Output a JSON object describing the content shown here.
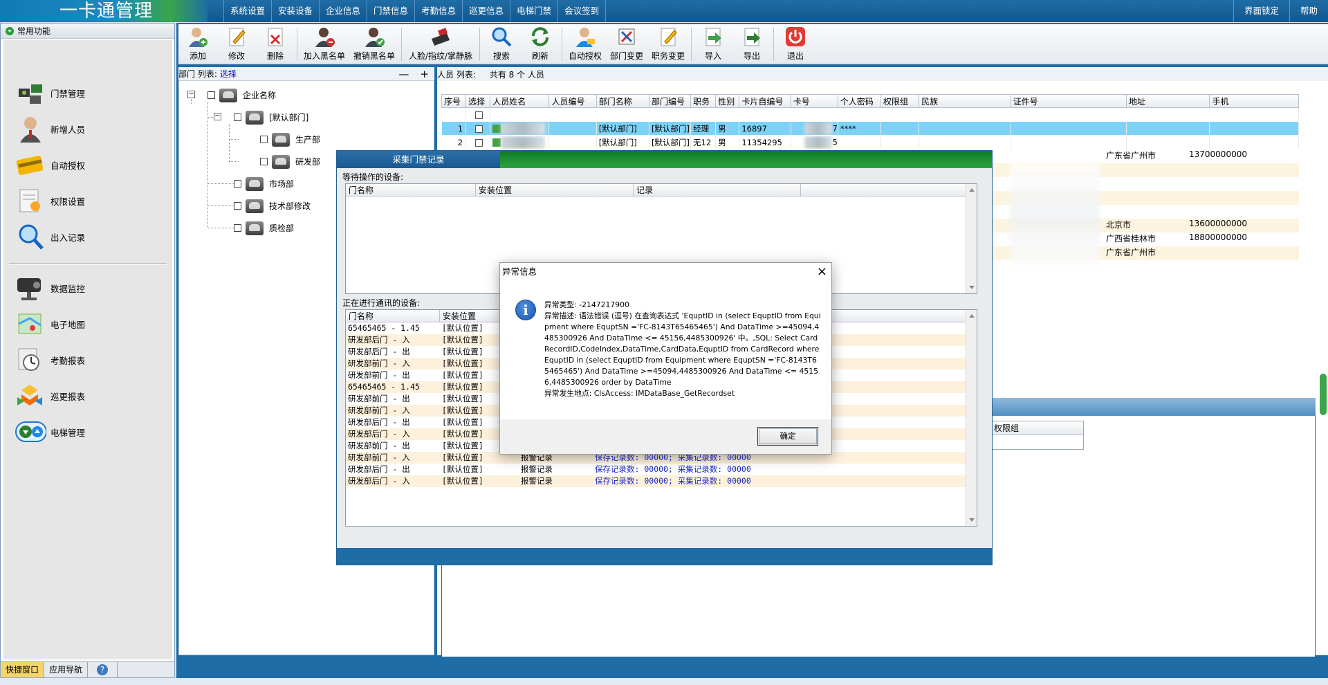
{
  "app": {
    "title": "一卡通管理"
  },
  "menu": [
    "系统设置",
    "安装设备",
    "企业信息",
    "门禁信息",
    "考勤信息",
    "巡更信息",
    "电梯门禁",
    "会议签到"
  ],
  "top_right": [
    "界面锁定",
    "帮助"
  ],
  "sidebar": {
    "header": "常用功能",
    "items": [
      "门禁管理",
      "新增人员",
      "自动授权",
      "权限设置",
      "出入记录",
      "数据监控",
      "电子地图",
      "考勤报表",
      "巡更报表",
      "电梯管理"
    ]
  },
  "bottom_tabs": [
    "快捷窗口",
    "应用导航"
  ],
  "toolbar": [
    "添加",
    "修改",
    "删除",
    "加入黑名单",
    "撤销黑名单",
    "人脸/指纹/掌静脉",
    "搜索",
    "刷新",
    "自动授权",
    "部门变更",
    "职务变更",
    "导入",
    "导出",
    "退出"
  ],
  "dept": {
    "list_label": "部门 列表:",
    "select_label": "选择",
    "minus": "—",
    "plus": "+",
    "nodes": [
      "企业名称",
      "[默认部门]",
      "生产部",
      "研发部",
      "市场部",
      "技术部修改",
      "质检部"
    ]
  },
  "person": {
    "list_label": "人员 列表:",
    "count_label": "共有 8  个 人员",
    "columns": [
      "序号",
      "选择",
      "人员姓名",
      "人员编号",
      "部门名称",
      "部门编号",
      "职务",
      "性别",
      "卡片自编号",
      "卡号",
      "个人密码",
      "权限组",
      "民族",
      "证件号",
      "地址",
      "手机"
    ],
    "rows": [
      {
        "no": "1",
        "dept": "[默认部门]",
        "deptno": "[默认部门]",
        "duty": "经理",
        "sex": "男",
        "cardno": "16897",
        "card_suffix": "7",
        "pwd": "****",
        "addr": "",
        "phone": ""
      },
      {
        "no": "2",
        "dept": "[默认部门]",
        "deptno": "[默认部门]",
        "duty": "无12",
        "sex": "男",
        "cardno": "11354295",
        "card_suffix": "5",
        "pwd": "",
        "addr": "",
        "phone": ""
      }
    ],
    "right_rows": [
      {
        "addr": "广东省广州市",
        "phone": "13700000000"
      },
      {
        "addr": "",
        "phone": ""
      },
      {
        "addr": "",
        "phone": ""
      },
      {
        "addr": "",
        "phone": ""
      },
      {
        "addr": "",
        "phone": ""
      },
      {
        "addr": "北京市",
        "phone": "13600000000"
      },
      {
        "addr": "广西省桂林市",
        "phone": "18800000000"
      },
      {
        "addr": "广东省广州市",
        "phone": ""
      }
    ],
    "lower_header": "权限组"
  },
  "collect": {
    "title": "采集门禁记录",
    "waiting_label": "等待操作的设备:",
    "waiting_cols": [
      "门名称",
      "安装位置",
      "记录"
    ],
    "comm_label": "正在进行通讯的设备:",
    "comm_cols": [
      "门名称",
      "安装位置"
    ],
    "rows": [
      {
        "door": "65465465 - 1.45",
        "loc": "[默认位置]",
        "rec": "",
        "status": ""
      },
      {
        "door": "研发部后门 - 入",
        "loc": "[默认位置]",
        "rec": "",
        "status": ""
      },
      {
        "door": "研发部后门 - 出",
        "loc": "[默认位置]",
        "rec": "",
        "status": ""
      },
      {
        "door": "研发部前门 - 入",
        "loc": "[默认位置]",
        "rec": "",
        "status": ""
      },
      {
        "door": "研发部前门 - 出",
        "loc": "[默认位置]",
        "rec": "",
        "status": ""
      },
      {
        "door": "65465465 - 1.45",
        "loc": "[默认位置]",
        "rec": "",
        "status": ""
      },
      {
        "door": "研发部前门 - 出",
        "loc": "[默认位置]",
        "rec": "",
        "status": ""
      },
      {
        "door": "研发部前门 - 入",
        "loc": "[默认位置]",
        "rec": "",
        "status": ""
      },
      {
        "door": "研发部后门 - 出",
        "loc": "[默认位置]",
        "rec": "",
        "status": ""
      },
      {
        "door": "研发部后门 - 入",
        "loc": "[默认位置]",
        "rec": "",
        "status": ""
      },
      {
        "door": "研发部前门 - 出",
        "loc": "[默认位置]",
        "rec": "",
        "status": ""
      },
      {
        "door": "研发部前门 - 入",
        "loc": "[默认位置]",
        "rec": "报警记录",
        "status": "保存记录数: 00000; 采集记录数: 00000"
      },
      {
        "door": "研发部后门 - 出",
        "loc": "[默认位置]",
        "rec": "报警记录",
        "status": "保存记录数: 00000; 采集记录数: 00000"
      },
      {
        "door": "研发部后门 - 入",
        "loc": "[默认位置]",
        "rec": "报警记录",
        "status": "保存记录数: 00000; 采集记录数: 00000"
      }
    ]
  },
  "dialog": {
    "title": "异常信息",
    "close": "×",
    "icon": "i",
    "type_line": "异常类型: -2147217900",
    "desc_line": "异常描述: 语法错误 (逗号) 在查询表达式 'EquptID in (select EquptID from Equipment where EquptSN ='FC-8143T65465465') And DataTime >=45094,4485300926 And DataTime <= 45156,4485300926' 中。,SQL: Select CardRecordID,CodeIndex,DataTime,CardData,EquptID from CardRecord where EquptID in (select EquptID from Equipment where EquptSN ='FC-8143T65465465') And DataTime >=45094,4485300926 And DataTime <= 45156,4485300926 order by DataTime",
    "where_line": "异常发生地点: ClsAccess: IMDataBase_GetRecordset",
    "ok": "确定"
  },
  "colors": {
    "titlebar": "#1f6da7",
    "selected_row": "#7dd3f7",
    "green_bar": "#2ea441"
  }
}
